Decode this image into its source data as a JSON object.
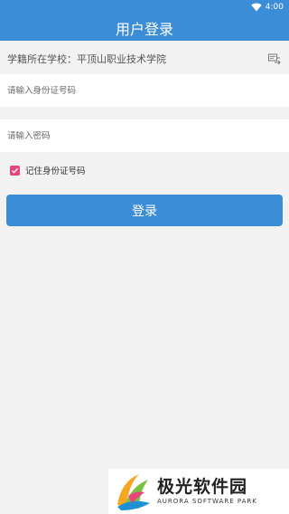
{
  "status_bar": {
    "time": "4:00"
  },
  "header": {
    "title": "用户登录"
  },
  "school": {
    "label": "学籍所在学校：平顶山职业技术学院"
  },
  "id_field": {
    "value": "",
    "placeholder": "请输入身份证号码"
  },
  "password_field": {
    "value": "",
    "placeholder": "请输入密码"
  },
  "remember": {
    "label": "记住身份证号码",
    "checked": true
  },
  "login_button": {
    "label": "登录"
  },
  "watermark": {
    "title": "极光软件园",
    "subtitle": "AURORA SOFTWARE PARK"
  },
  "colors": {
    "primary": "#3c8dd8",
    "checkbox": "#e8457a",
    "background": "#f2f2f2"
  },
  "icons": [
    "wifi-icon",
    "switch-school-icon",
    "checkbox-checked-icon",
    "aurora-logo"
  ]
}
